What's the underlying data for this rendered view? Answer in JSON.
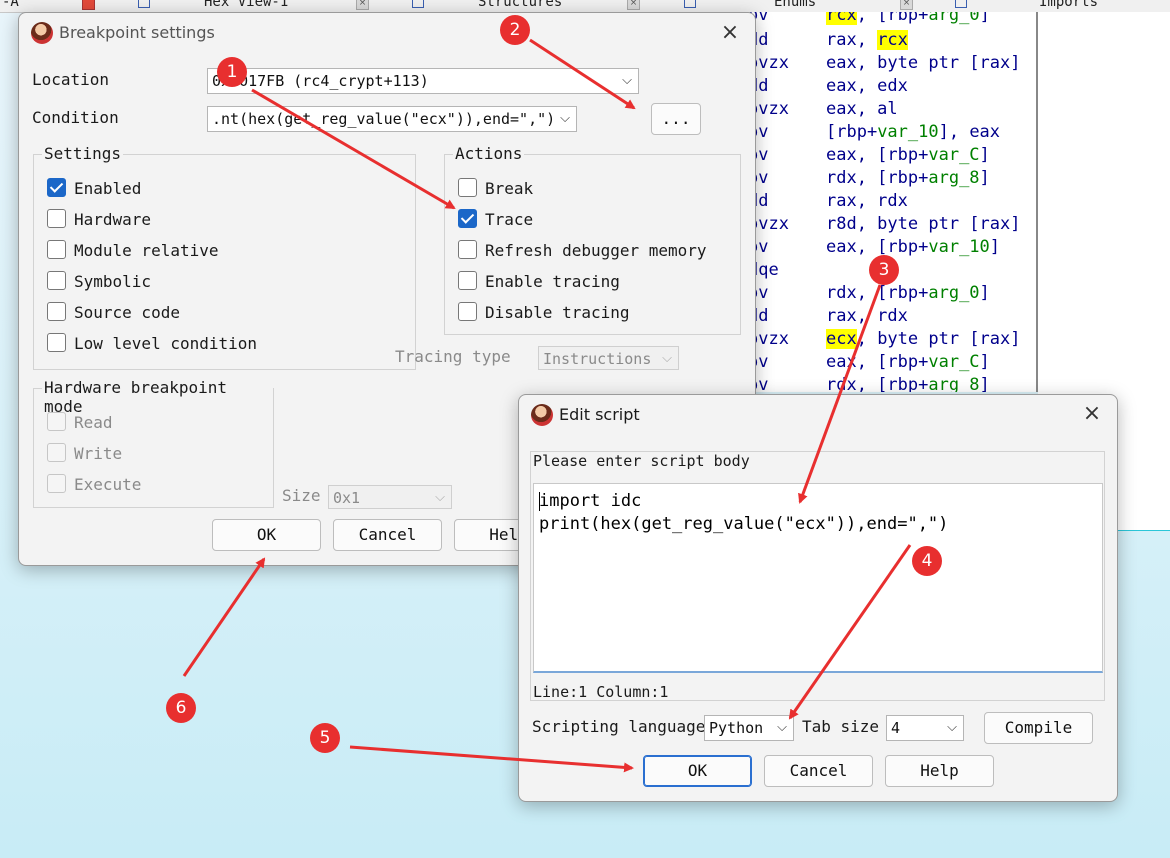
{
  "tabs": [
    {
      "label": "-A"
    },
    {
      "label": "Hex View-1"
    },
    {
      "label": "Structures"
    },
    {
      "label": "Enums"
    },
    {
      "label": "Imports"
    }
  ],
  "disasm": [
    {
      "mn": "ov",
      "op": "rcx, [rbp+arg_0]"
    },
    {
      "mn": "dd",
      "op": "rax, rcx"
    },
    {
      "mn": "ovzx",
      "op": "eax, byte ptr [rax]"
    },
    {
      "mn": "dd",
      "op": "eax, edx"
    },
    {
      "mn": "ovzx",
      "op": "eax, al"
    },
    {
      "mn": "ov",
      "op": "[rbp+var_10], eax"
    },
    {
      "mn": "ov",
      "op": "eax, [rbp+var_C]"
    },
    {
      "mn": "ov",
      "op": "rdx, [rbp+arg_8]"
    },
    {
      "mn": "dd",
      "op": "rax, rdx"
    },
    {
      "mn": "ovzx",
      "op": "r8d, byte ptr [rax]"
    },
    {
      "mn": "ov",
      "op": "eax, [rbp+var_10]"
    },
    {
      "mn": "dqe",
      "op": ""
    },
    {
      "mn": "ov",
      "op": "rdx, [rbp+arg_0]"
    },
    {
      "mn": "dd",
      "op": "rax, rdx"
    },
    {
      "mn": "ovzx",
      "op": "ecx, byte ptr [rax]"
    },
    {
      "mn": "ov",
      "op": "eax, [rbp+var_C]"
    },
    {
      "mn": "ov",
      "op": "rdx, [rbp+arg_8]"
    }
  ],
  "bp_dialog": {
    "title": "Breakpoint settings",
    "location_label": "Location",
    "location_value": "0x0017FB (rc4_crypt+113)",
    "condition_label": "Condition",
    "condition_value": ".nt(hex(get_reg_value(\"ecx\")),end=\",\")",
    "ellipsis": "...",
    "settings_title": "Settings",
    "settings": [
      {
        "label": "Enabled",
        "checked": true
      },
      {
        "label": "Hardware",
        "checked": false
      },
      {
        "label": "Module relative",
        "checked": false
      },
      {
        "label": "Symbolic",
        "checked": false
      },
      {
        "label": "Source code",
        "checked": false
      },
      {
        "label": "Low level condition",
        "checked": false
      }
    ],
    "actions_title": "Actions",
    "actions": [
      {
        "label": "Break",
        "checked": false
      },
      {
        "label": "Trace",
        "checked": true
      },
      {
        "label": "Refresh debugger memory",
        "checked": false
      },
      {
        "label": "Enable tracing",
        "checked": false
      },
      {
        "label": "Disable tracing",
        "checked": false
      }
    ],
    "tracing_type_label": "Tracing type",
    "tracing_type_value": "Instructions",
    "hw_title": "Hardware breakpoint mode",
    "hw_modes": [
      {
        "label": "Read"
      },
      {
        "label": "Write"
      },
      {
        "label": "Execute"
      }
    ],
    "size_label": "Size",
    "size_value": "0x1",
    "ok": "OK",
    "cancel": "Cancel",
    "help": "Help"
  },
  "script_dialog": {
    "title": "Edit script",
    "prompt": "Please enter script body",
    "code_line1": "import idc",
    "code_line2": "print(hex(get_reg_value(\"ecx\")),end=\",\")",
    "status": "Line:1  Column:1",
    "lang_label": "Scripting language",
    "lang_value": "Python",
    "tab_label": "Tab size",
    "tab_value": "4",
    "compile": "Compile",
    "ok": "OK",
    "cancel": "Cancel",
    "help": "Help"
  },
  "markers": [
    "1",
    "2",
    "3",
    "4",
    "5",
    "6"
  ],
  "colors": {
    "annotation": "#e82f2f",
    "check": "#1b67c8",
    "highlight": "#ffff00"
  }
}
